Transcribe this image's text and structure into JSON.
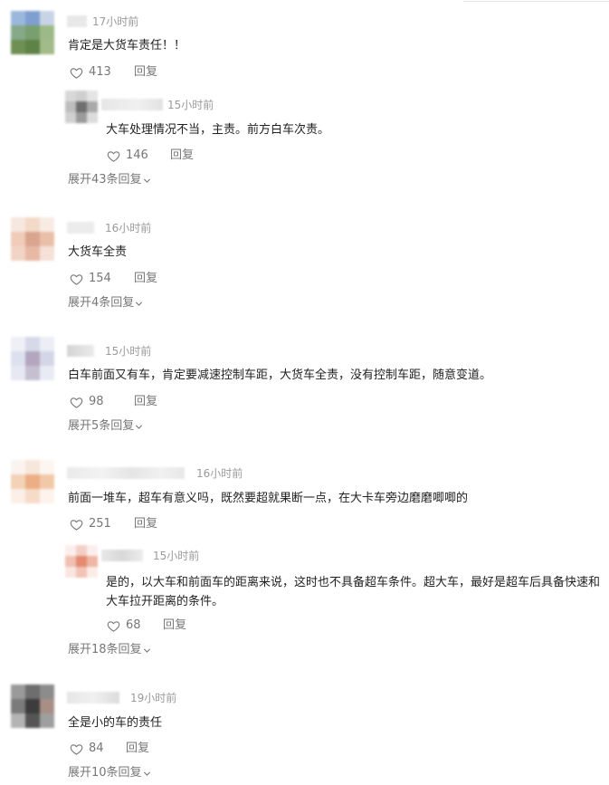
{
  "comments": [
    {
      "time": "17小时前",
      "text": "肯定是大货车责任！！",
      "likes": "413",
      "reply_label": "回复",
      "sub_reply": {
        "time": "15小时前",
        "text": "大车处理情况不当，主责。前方白车次责。",
        "likes": "146",
        "reply_label": "回复"
      },
      "expand_label": "展开43条回复"
    },
    {
      "time": "16小时前",
      "text": "大货车全责",
      "likes": "154",
      "reply_label": "回复",
      "expand_label": "展开4条回复"
    },
    {
      "time": "15小时前",
      "text": "白车前面又有车，肯定要减速控制车距，大货车全责，没有控制车距，随意变道。",
      "likes": "98",
      "reply_label": "回复",
      "expand_label": "展开5条回复"
    },
    {
      "time": "16小时前",
      "text": "前面一堆车，超车有意义吗，既然要超就果断一点，在大卡车旁边磨磨唧唧的",
      "likes": "251",
      "reply_label": "回复",
      "sub_reply": {
        "time": "15小时前",
        "text": "是的，以大车和前面车的距离来说，这时也不具备超车条件。超大车，最好是超车后具备快速和大车拉开距离的条件。",
        "likes": "68",
        "reply_label": "回复"
      },
      "expand_label": "展开18条回复"
    },
    {
      "time": "19小时前",
      "text": "全是小的车的责任",
      "likes": "84",
      "reply_label": "回复",
      "expand_label": "展开10条回复"
    }
  ],
  "icons": {
    "like": "heart-outline-icon",
    "expand": "chevron-down-icon"
  },
  "colors": {
    "text": "#222222",
    "meta": "#9a9a9a",
    "action": "#777777"
  }
}
